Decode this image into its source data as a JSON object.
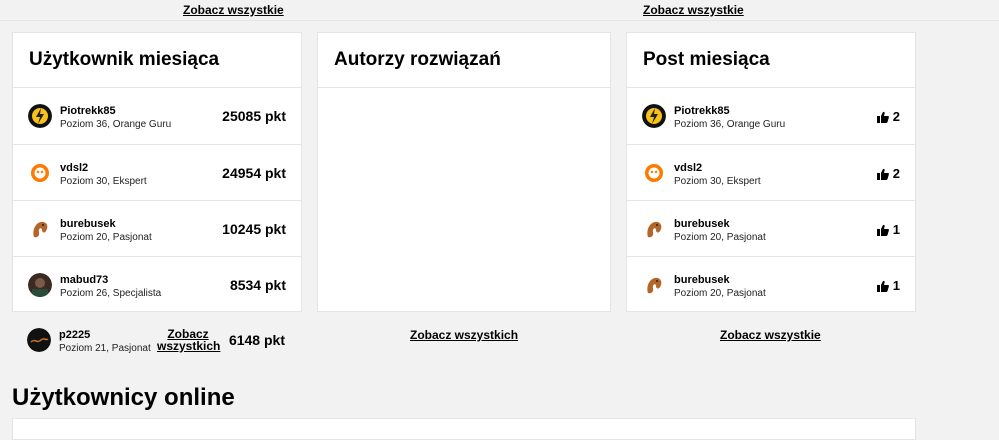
{
  "top_links": {
    "left": "Zobacz wszystkie",
    "right": "Zobacz wszystkie"
  },
  "user_of_month": {
    "title": "Użytkownik miesiąca",
    "rows": [
      {
        "name": "Piotrekk85",
        "level": "Poziom 36, Orange Guru",
        "points": "25085 pkt",
        "avatar_icon": "lightning-avatar-icon"
      },
      {
        "name": "vdsl2",
        "level": "Poziom 30, Ekspert",
        "points": "24954 pkt",
        "avatar_icon": "orange-face-avatar-icon"
      },
      {
        "name": "burebusek",
        "level": "Poziom 20, Pasjonat",
        "points": "10245 pkt",
        "avatar_icon": "squirrel-avatar-icon"
      },
      {
        "name": "mabud73",
        "level": "Poziom 26, Specjalista",
        "points": "8534 pkt",
        "avatar_icon": "photo-avatar-icon"
      },
      {
        "name": "p2225",
        "level": "Poziom 21, Pasjonat",
        "points": "6148 pkt",
        "avatar_icon": "dark-avatar-icon"
      }
    ],
    "see_all": "Zobacz wszystkich"
  },
  "solution_authors": {
    "title": "Autorzy rozwiązań",
    "see_all": "Zobacz wszystkich"
  },
  "post_of_month": {
    "title": "Post miesiąca",
    "rows": [
      {
        "name": "Piotrekk85",
        "level": "Poziom 36, Orange Guru",
        "likes": "2",
        "avatar_icon": "lightning-avatar-icon"
      },
      {
        "name": "vdsl2",
        "level": "Poziom 30, Ekspert",
        "likes": "2",
        "avatar_icon": "orange-face-avatar-icon"
      },
      {
        "name": "burebusek",
        "level": "Poziom 20, Pasjonat",
        "likes": "1",
        "avatar_icon": "squirrel-avatar-icon"
      },
      {
        "name": "burebusek",
        "level": "Poziom 20, Pasjonat",
        "likes": "1",
        "avatar_icon": "squirrel-avatar-icon"
      }
    ],
    "see_all": "Zobacz wszystkie"
  },
  "online": {
    "title": "Użytkownicy online"
  },
  "colors": {
    "accent": "#ff7900",
    "border": "#e4e4e4",
    "background": "#f2f2f2"
  }
}
